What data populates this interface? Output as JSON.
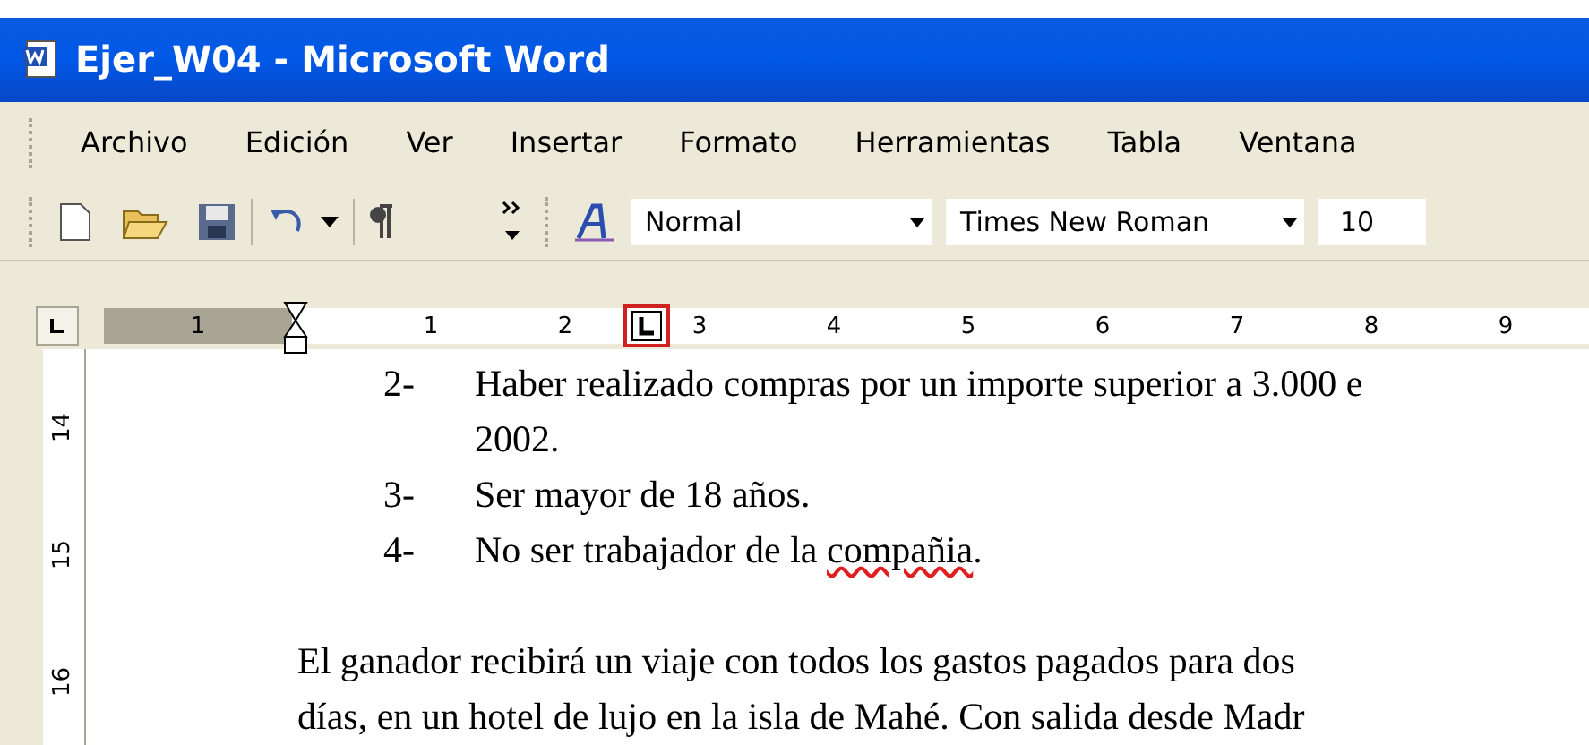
{
  "window": {
    "title": "Ejer_W04 - Microsoft Word"
  },
  "menu": [
    "Archivo",
    "Edición",
    "Ver",
    "Insertar",
    "Formato",
    "Herramientas",
    "Tabla",
    "Ventana"
  ],
  "toolbar": {
    "style": "Normal",
    "font": "Times New Roman",
    "size": "10"
  },
  "ruler": {
    "numbers": [
      {
        "label": "1",
        "kind": "margin"
      },
      {
        "label": "1",
        "kind": "text"
      },
      {
        "label": "2",
        "kind": "text"
      },
      {
        "label": "3",
        "kind": "text"
      },
      {
        "label": "4",
        "kind": "text"
      },
      {
        "label": "5",
        "kind": "text"
      },
      {
        "label": "6",
        "kind": "text"
      },
      {
        "label": "7",
        "kind": "text"
      },
      {
        "label": "8",
        "kind": "text"
      },
      {
        "label": "9",
        "kind": "text"
      }
    ]
  },
  "vertical_ruler": [
    "14",
    "15",
    "16"
  ],
  "document": {
    "list": [
      {
        "number": "2-",
        "lines": [
          [
            {
              "text": "Haber realizado compras por un importe superior a 3.000 e",
              "misspelled": false
            }
          ],
          [
            {
              "text": "2002.",
              "misspelled": false
            }
          ]
        ]
      },
      {
        "number": "3-",
        "lines": [
          [
            {
              "text": "Ser mayor de 18 años.",
              "misspelled": false
            }
          ]
        ]
      },
      {
        "number": "4-",
        "lines": [
          [
            {
              "text": "No ser trabajador de la ",
              "misspelled": false
            },
            {
              "text": "compañia",
              "misspelled": true
            },
            {
              "text": ".",
              "misspelled": false
            }
          ]
        ]
      }
    ],
    "paragraph": [
      "El ganador recibirá un viaje con todos los gastos pagados para dos",
      "días, en un hotel de lujo en la isla de Mahé. Con salida desde Madr"
    ]
  }
}
